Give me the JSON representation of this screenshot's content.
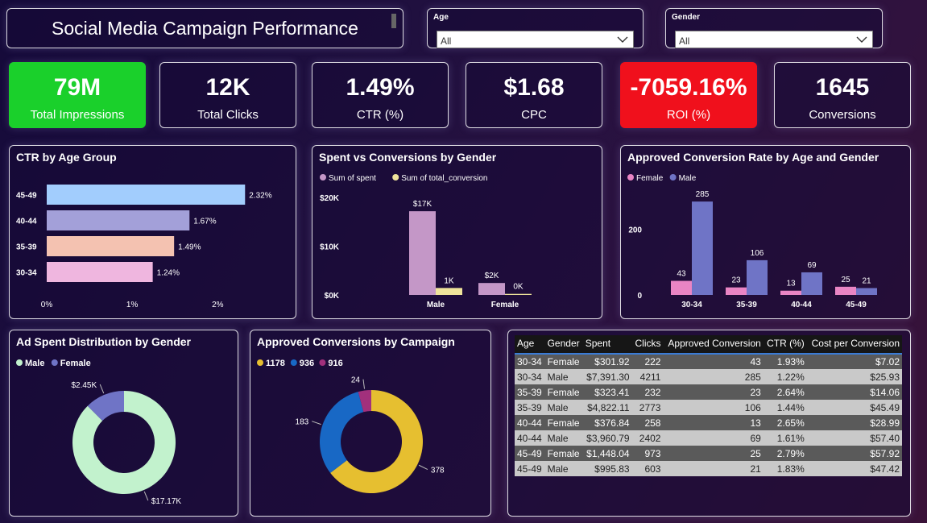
{
  "header": {
    "title": "Social Media Campaign Performance"
  },
  "filters": [
    {
      "label": "Age",
      "value": "All"
    },
    {
      "label": "Gender",
      "value": "All"
    }
  ],
  "kpis": [
    {
      "value": "79M",
      "label": "Total Impressions",
      "color": "#1ad02b"
    },
    {
      "value": "12K",
      "label": "Total Clicks"
    },
    {
      "value": "1.49%",
      "label": "CTR (%)"
    },
    {
      "value": "$1.68",
      "label": "CPC"
    },
    {
      "value": "-7059.16%",
      "label": "ROI (%)",
      "color": "#f0101c"
    },
    {
      "value": "1645",
      "label": "Conversions"
    }
  ],
  "chart_data": [
    {
      "type": "bar",
      "orientation": "horizontal",
      "title": "CTR by Age Group",
      "categories": [
        "45-49",
        "40-44",
        "35-39",
        "30-34"
      ],
      "values": [
        2.32,
        1.67,
        1.49,
        1.24
      ],
      "labels": [
        "2.32%",
        "1.67%",
        "1.49%",
        "1.24%"
      ],
      "colors": [
        "#a2cdfd",
        "#a3a0d9",
        "#f4c2b1",
        "#efb6df"
      ],
      "xticks": [
        "0%",
        "1%",
        "2%"
      ],
      "xlim": [
        0,
        2.6
      ]
    },
    {
      "type": "bar",
      "title": "Spent vs Conversions by Gender",
      "categories": [
        "Male",
        "Female"
      ],
      "legend_position": "top-left",
      "series": [
        {
          "name": "Sum of spent",
          "values": [
            17170,
            2450
          ],
          "labels": [
            "$17K",
            "$2K"
          ],
          "color": "#c497c7"
        },
        {
          "name": "Sum of total_conversion",
          "values": [
            1430,
            215
          ],
          "labels": [
            "1K",
            "0K"
          ],
          "color": "#efe49b"
        }
      ],
      "yticks": [
        "$0K",
        "$10K",
        "$20K"
      ],
      "ylim": [
        0,
        20000
      ]
    },
    {
      "type": "bar",
      "title": "Approved Conversion Rate by Age and Gender",
      "categories": [
        "30-34",
        "35-39",
        "40-44",
        "45-49"
      ],
      "legend_position": "top-left",
      "series": [
        {
          "name": "Female",
          "values": [
            43,
            23,
            13,
            25
          ],
          "color": "#e985c4"
        },
        {
          "name": "Male",
          "values": [
            285,
            106,
            69,
            21
          ],
          "color": "#6f74c6"
        }
      ],
      "yticks": [
        "0",
        "200"
      ],
      "ylim": [
        0,
        300
      ]
    },
    {
      "type": "pie",
      "donut": true,
      "title": "Ad Spent Distribution by Gender",
      "legend_position": "top-left",
      "categories": [
        "Male",
        "Female"
      ],
      "values": [
        17170,
        2450
      ],
      "labels": [
        "$17.17K",
        "$2.45K"
      ],
      "colors": [
        "#c2f2cd",
        "#6f74c6"
      ]
    },
    {
      "type": "pie",
      "donut": true,
      "title": "Approved Conversions by Campaign",
      "legend_position": "top-left",
      "categories": [
        "1178",
        "936",
        "916"
      ],
      "values": [
        378,
        183,
        24
      ],
      "labels": [
        "378",
        "183",
        "24"
      ],
      "colors": [
        "#e6bf30",
        "#1868c5",
        "#a2307c"
      ]
    }
  ],
  "table": {
    "columns": [
      "Age",
      "Gender",
      "Spent",
      "Clicks",
      "Approved Conversion",
      "CTR (%)",
      "Cost per Conversion"
    ],
    "rows": [
      [
        "30-34",
        "Female",
        "$301.92",
        "222",
        "43",
        "1.93%",
        "$7.02"
      ],
      [
        "30-34",
        "Male",
        "$7,391.30",
        "4211",
        "285",
        "1.22%",
        "$25.93"
      ],
      [
        "35-39",
        "Female",
        "$323.41",
        "232",
        "23",
        "2.64%",
        "$14.06"
      ],
      [
        "35-39",
        "Male",
        "$4,822.11",
        "2773",
        "106",
        "1.44%",
        "$45.49"
      ],
      [
        "40-44",
        "Female",
        "$376.84",
        "258",
        "13",
        "2.65%",
        "$28.99"
      ],
      [
        "40-44",
        "Male",
        "$3,960.79",
        "2402",
        "69",
        "1.61%",
        "$57.40"
      ],
      [
        "45-49",
        "Female",
        "$1,448.04",
        "973",
        "25",
        "2.79%",
        "$57.92"
      ],
      [
        "45-49",
        "Male",
        "$995.83",
        "603",
        "21",
        "1.83%",
        "$47.42"
      ]
    ]
  }
}
